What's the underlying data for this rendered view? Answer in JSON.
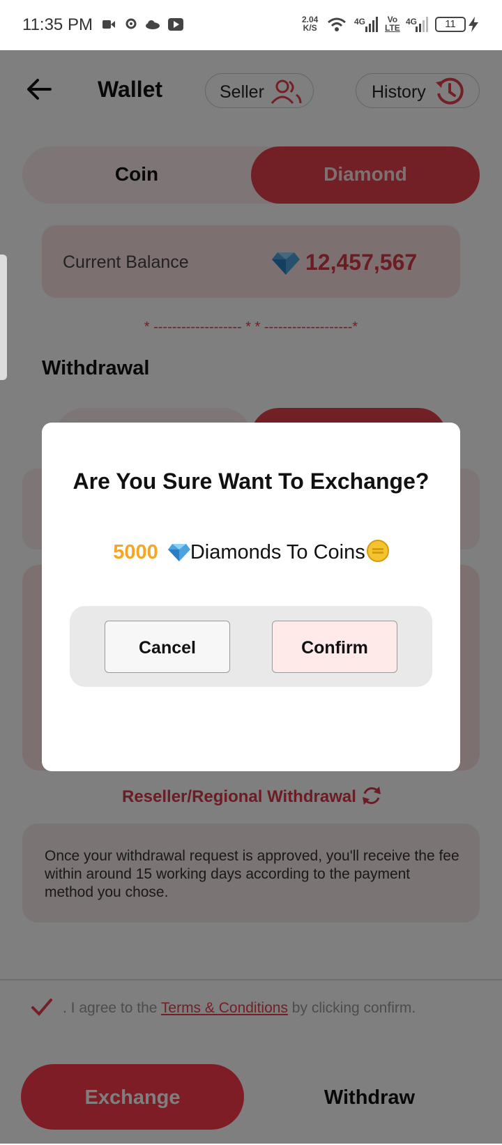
{
  "status_bar": {
    "time": "11:35 PM",
    "speed_value": "2.04",
    "speed_unit": "K/S",
    "net1": "4G",
    "volte_top": "Vo",
    "volte_bottom": "LTE",
    "net2": "4G",
    "battery": "11"
  },
  "header": {
    "title": "Wallet",
    "seller_label": "Seller",
    "history_label": "History"
  },
  "tabs": {
    "coin": "Coin",
    "diamond": "Diamond"
  },
  "balance": {
    "label": "Current Balance",
    "value": "12,457,567"
  },
  "divider_text": "* ------------------- * * -------------------*",
  "withdrawal_title": "Withdrawal",
  "reseller_link": "Reseller/Regional Withdrawal",
  "info_text": "Once your withdrawal request is approved, you'll receive the fee within around 15 working days according to the payment method you chose.",
  "agree": {
    "prefix": ". I agree to the ",
    "link": "Terms & Conditions",
    "suffix": " by clicking confirm."
  },
  "buttons": {
    "exchange": "Exchange",
    "withdraw": "Withdraw"
  },
  "dialog": {
    "title": "Are You Sure Want To Exchange?",
    "amount": "5000",
    "message": "Diamonds To Coins",
    "cancel": "Cancel",
    "confirm": "Confirm"
  },
  "colors": {
    "accent": "#e63f4d",
    "amount": "#f6a623"
  },
  "icons": [
    "back-arrow-icon",
    "people-icon",
    "history-clock-icon",
    "diamond-icon",
    "refresh-icon",
    "checkmark-icon",
    "coin-icon"
  ]
}
